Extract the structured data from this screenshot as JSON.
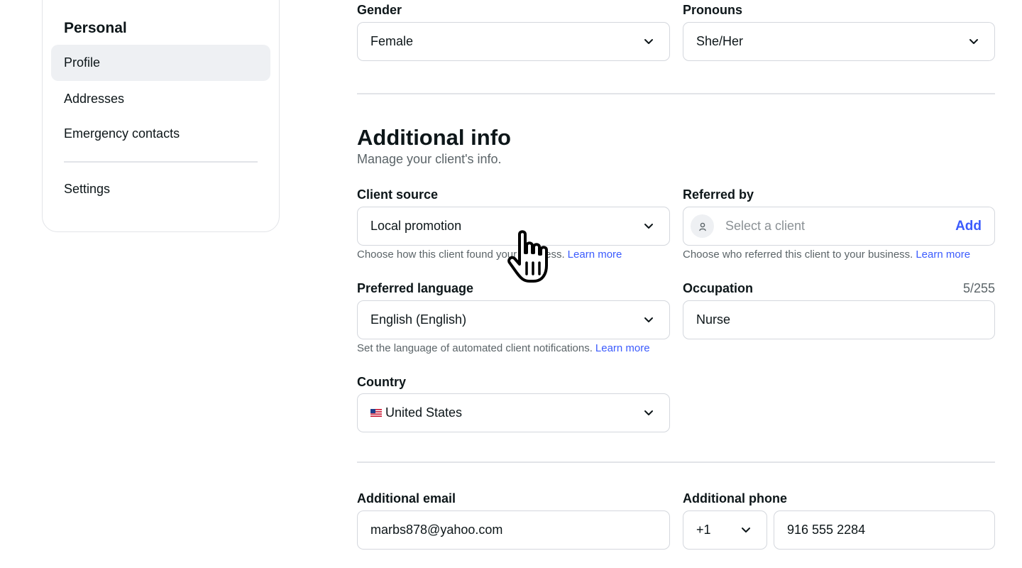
{
  "sidebar": {
    "heading": "Personal",
    "items": [
      {
        "label": "Profile",
        "active": true
      },
      {
        "label": "Addresses"
      },
      {
        "label": "Emergency contacts"
      },
      {
        "label": "Settings"
      }
    ]
  },
  "gender": {
    "label": "Gender",
    "value": "Female"
  },
  "pronouns": {
    "label": "Pronouns",
    "value": "She/Her"
  },
  "additional_info": {
    "title": "Additional info",
    "subtitle": "Manage your client's info."
  },
  "client_source": {
    "label": "Client source",
    "value": "Local promotion",
    "hint": "Choose how this client found your business.",
    "link": "Learn more"
  },
  "referred_by": {
    "label": "Referred by",
    "placeholder": "Select a client",
    "add_label": "Add",
    "hint": "Choose who referred this client to your business.",
    "link": "Learn more"
  },
  "preferred_language": {
    "label": "Preferred language",
    "value": "English (English)",
    "hint": "Set the language of automated client notifications.",
    "link": "Learn more"
  },
  "occupation": {
    "label": "Occupation",
    "value": "Nurse",
    "counter": "5/255"
  },
  "country": {
    "label": "Country",
    "value": "United States",
    "flag": "us-flag-icon"
  },
  "additional_email": {
    "label": "Additional email",
    "value": "marbs878@yahoo.com"
  },
  "additional_phone": {
    "label": "Additional phone",
    "country_code": "+1",
    "value": "916 555 2284"
  },
  "colors": {
    "accent": "#3b5bfd",
    "border": "#d4d7dd",
    "text": "#0d1619",
    "muted": "#5b6468"
  }
}
